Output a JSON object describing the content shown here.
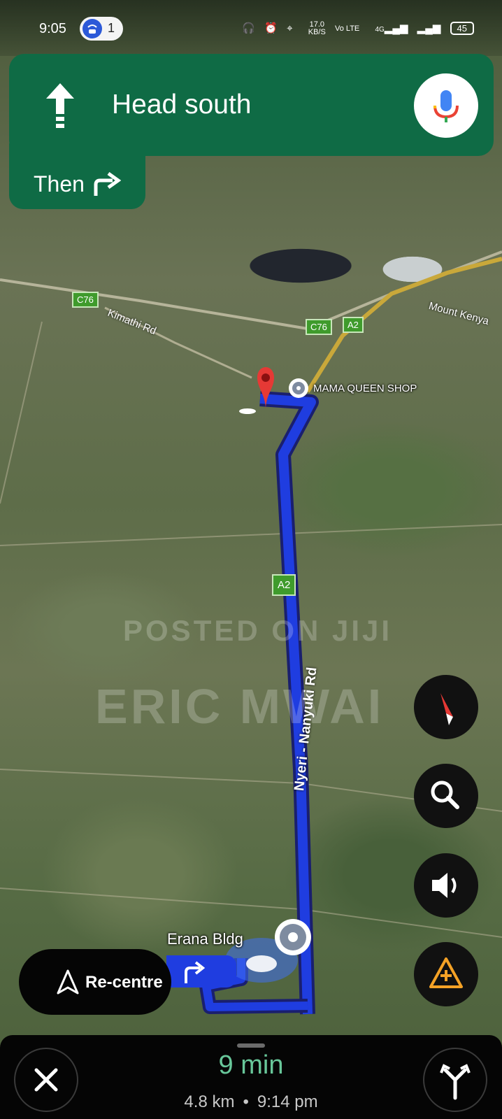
{
  "status_bar": {
    "time": "9:05",
    "hotspot_count": "1",
    "data_speed_value": "17.0",
    "data_speed_unit": "KB/S",
    "volte": "Vo LTE",
    "network": "4G",
    "battery": "45",
    "icons": [
      "headphones-icon",
      "alarm-icon",
      "location-icon",
      "signal-icon",
      "signal-2-icon"
    ]
  },
  "navigation": {
    "instruction": "Head south",
    "direction_icon": "arrow-straight-icon",
    "then_label": "Then",
    "then_icon": "turn-right-icon",
    "mic_icon": "microphone-icon"
  },
  "map": {
    "road_labels": [
      "Kimathi Rd",
      "Nyeri - Nanyuki Rd",
      "Mount Kenya"
    ],
    "shields": [
      "C76",
      "C76",
      "A2",
      "A2"
    ],
    "places": [
      "MAMA QUEEN SHOP",
      "Erana Bldg"
    ],
    "watermark_line1": "POSTED ON JIJI",
    "watermark_line2": "ERIC MWAI"
  },
  "controls": {
    "compass_icon": "compass-icon",
    "search_icon": "search-icon",
    "sound_icon": "volume-icon",
    "report_icon": "report-incident-icon",
    "recentre_label": "Re-centre"
  },
  "trip": {
    "duration": "9 min",
    "distance": "4.8 km",
    "separator": "•",
    "arrival": "9:14 pm"
  },
  "colors": {
    "nav_green": "#0f6b45",
    "route_blue": "#1f3de0",
    "eta_green": "#68c79a"
  }
}
